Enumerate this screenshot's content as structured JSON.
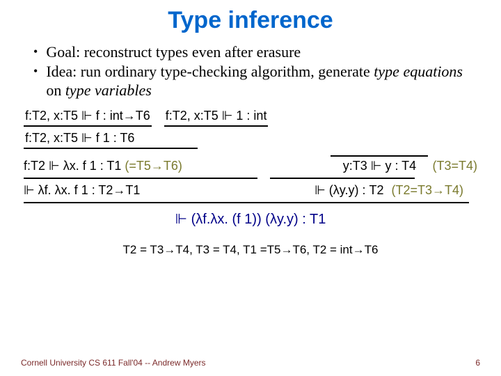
{
  "title": "Type inference",
  "bullets": [
    {
      "text": "Goal: reconstruct types even after erasure"
    },
    {
      "text_pre": "Idea: run ordinary type-checking algorithm, generate ",
      "em1": "type equations",
      "mid": " on ",
      "em2": "type variables"
    }
  ],
  "deriv": {
    "r1a": "f:T2, x:T5 ⊩ f : int→T6",
    "r1b": "f:T2, x:T5 ⊩ 1 : int",
    "r2": "f:T2, x:T5 ⊩ f 1 : T6",
    "r3": "f:T2 ⊩ λx. f 1 : T1",
    "r3note": "(=T5→T6)",
    "r4": "⊩ λf. λx. f 1 : T2→T1",
    "y_top": "",
    "y_bot": "y:T3 ⊩ y : T4",
    "y_note": "(T3=T4)",
    "y_lam": "⊩ (λy.y) : T2",
    "y_lam_note": "(T2=T3→T4)",
    "final": "⊩ (λf.λx. (f 1)) (λy.y) : T1",
    "equations": "T2 = T3→T4, T3 = T4, T1 =T5→T6, T2 = int→T6"
  },
  "footer": {
    "left": "Cornell University CS 611 Fall'04 -- Andrew Myers",
    "page": "6"
  }
}
